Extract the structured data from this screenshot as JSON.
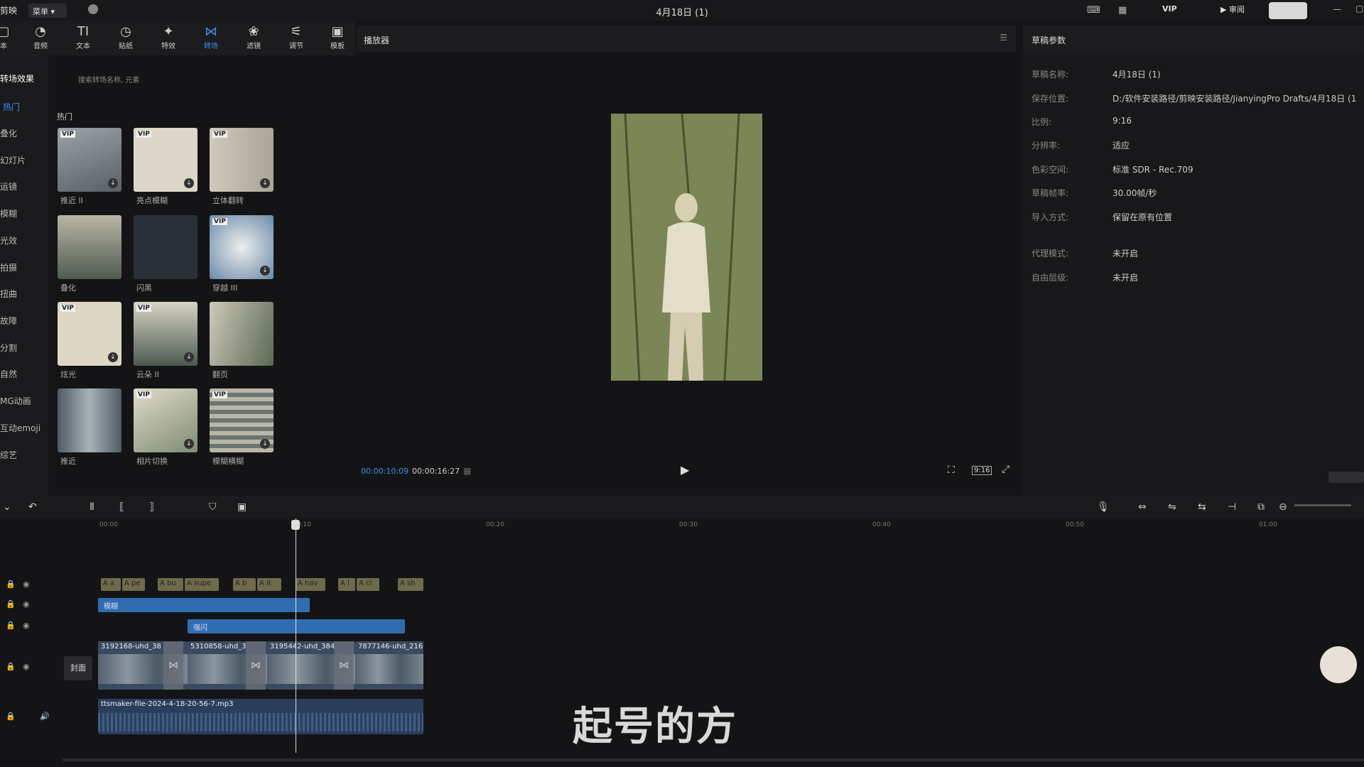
{
  "topbar": {
    "app": "剪映",
    "menu": "菜单",
    "title": "4月18日 (1)",
    "vip": "VIP",
    "review": "审阅"
  },
  "tools": [
    {
      "label": "本",
      "icon": "media-icon"
    },
    {
      "label": "音频",
      "icon": "audio-icon"
    },
    {
      "label": "文本",
      "icon": "text-icon"
    },
    {
      "label": "贴纸",
      "icon": "sticker-icon"
    },
    {
      "label": "特效",
      "icon": "effects-icon"
    },
    {
      "label": "转场",
      "icon": "transition-icon"
    },
    {
      "label": "滤镜",
      "icon": "filter-icon"
    },
    {
      "label": "调节",
      "icon": "adjust-icon"
    },
    {
      "label": "模板",
      "icon": "template-icon"
    }
  ],
  "sidebar": {
    "items": [
      "转场效果",
      "热门",
      "叠化",
      "幻灯片",
      "运镜",
      "模糊",
      "光效",
      "拍摄",
      "扭曲",
      "故障",
      "分割",
      "自然",
      "MG动画",
      "互动emoji",
      "综艺"
    ]
  },
  "effects": {
    "search_placeholder": "搜索转场名称, 元素",
    "section": "热门",
    "cards": [
      {
        "label": "推近 II",
        "vip": "VIP"
      },
      {
        "label": "亮点模糊",
        "vip": "VIP"
      },
      {
        "label": "立体翻转",
        "vip": "VIP"
      },
      {
        "label": "叠化",
        "vip": ""
      },
      {
        "label": "闪黑",
        "vip": ""
      },
      {
        "label": "穿越 III",
        "vip": "VIP"
      },
      {
        "label": "炫光",
        "vip": "VIP"
      },
      {
        "label": "云朵 II",
        "vip": "VIP"
      },
      {
        "label": "翻页",
        "vip": ""
      },
      {
        "label": "推近",
        "vip": ""
      },
      {
        "label": "相片切换",
        "vip": "VIP"
      },
      {
        "label": "模糊横糊",
        "vip": "VIP"
      }
    ]
  },
  "player": {
    "title": "播放器",
    "current_time": "00:00:10:09",
    "total_time": "00:00:16:27",
    "ratio": "9:16"
  },
  "props": {
    "title": "草稿参数",
    "rows": [
      {
        "label": "草稿名称:",
        "value": "4月18日 (1)"
      },
      {
        "label": "保存位置:",
        "value": "D:/软件安装路径/剪映安装路径/JianyingPro Drafts/4月18日 (1"
      },
      {
        "label": "比例:",
        "value": "9:16"
      },
      {
        "label": "分辨率:",
        "value": "适应"
      },
      {
        "label": "色彩空间:",
        "value": "标准 SDR - Rec.709"
      },
      {
        "label": "草稿帧率:",
        "value": "30.00帧/秒"
      },
      {
        "label": "导入方式:",
        "value": "保留在原有位置"
      },
      {
        "label": "代理模式:",
        "value": "未开启"
      },
      {
        "label": "自由层级:",
        "value": "未开启"
      }
    ]
  },
  "timeline": {
    "ticks": [
      "00:00",
      "00:10",
      "00:20",
      "00:30",
      "00:40",
      "00:50",
      "01:00"
    ],
    "text_clips": [
      "A a",
      "A pe",
      "A bu",
      "A supe",
      "A b",
      "A it",
      "A hav",
      "A l",
      "A cl",
      "A sh"
    ],
    "fx_clips": [
      "模糊",
      "强闪"
    ],
    "video_clips": [
      "3192168-uhd_38",
      "5310858-uhd_3",
      "3195442-uhd_384",
      "7877146-uhd_216"
    ],
    "cover": "封面",
    "audio_clip": "ttsmaker-file-2024-4-18-20-56-7.mp3"
  },
  "subtitle": "起号的方"
}
